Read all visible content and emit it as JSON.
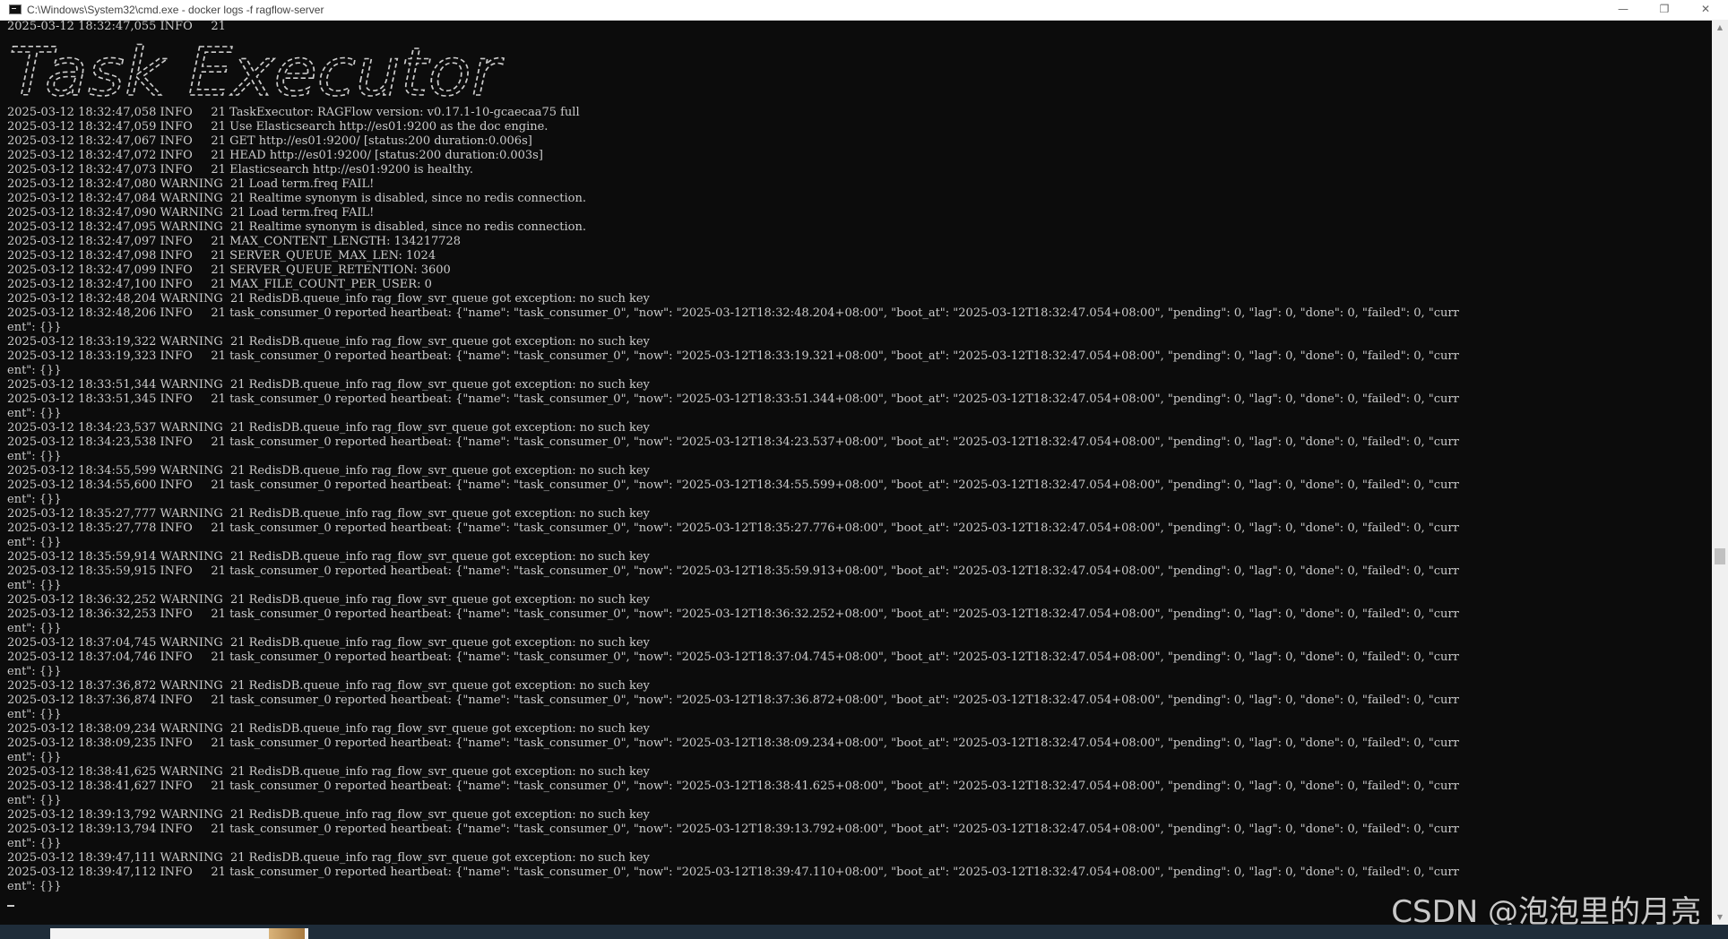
{
  "window": {
    "title": "C:\\Windows\\System32\\cmd.exe - docker  logs -f ragflow-server",
    "minimize_glyph": "—",
    "maximize_glyph": "❐",
    "close_glyph": "✕"
  },
  "console": {
    "first_line": "2025-03-12 18:32:47,055 INFO     21",
    "banner_text": "Task Executor",
    "lines": [
      "2025-03-12 18:32:47,058 INFO     21 TaskExecutor: RAGFlow version: v0.17.1-10-gcaecaa75 full",
      "2025-03-12 18:32:47,059 INFO     21 Use Elasticsearch http://es01:9200 as the doc engine.",
      "2025-03-12 18:32:47,067 INFO     21 GET http://es01:9200/ [status:200 duration:0.006s]",
      "2025-03-12 18:32:47,072 INFO     21 HEAD http://es01:9200/ [status:200 duration:0.003s]",
      "2025-03-12 18:32:47,073 INFO     21 Elasticsearch http://es01:9200 is healthy.",
      "2025-03-12 18:32:47,080 WARNING  21 Load term.freq FAIL!",
      "2025-03-12 18:32:47,084 WARNING  21 Realtime synonym is disabled, since no redis connection.",
      "2025-03-12 18:32:47,090 WARNING  21 Load term.freq FAIL!",
      "2025-03-12 18:32:47,095 WARNING  21 Realtime synonym is disabled, since no redis connection.",
      "2025-03-12 18:32:47,097 INFO     21 MAX_CONTENT_LENGTH: 134217728",
      "2025-03-12 18:32:47,098 INFO     21 SERVER_QUEUE_MAX_LEN: 1024",
      "2025-03-12 18:32:47,099 INFO     21 SERVER_QUEUE_RETENTION: 3600",
      "2025-03-12 18:32:47,100 INFO     21 MAX_FILE_COUNT_PER_USER: 0",
      "2025-03-12 18:32:48,204 WARNING  21 RedisDB.queue_info rag_flow_svr_queue got exception: no such key",
      "2025-03-12 18:32:48,206 INFO     21 task_consumer_0 reported heartbeat: {\"name\": \"task_consumer_0\", \"now\": \"2025-03-12T18:32:48.204+08:00\", \"boot_at\": \"2025-03-12T18:32:47.054+08:00\", \"pending\": 0, \"lag\": 0, \"done\": 0, \"failed\": 0, \"curr",
      "ent\": {}}",
      "2025-03-12 18:33:19,322 WARNING  21 RedisDB.queue_info rag_flow_svr_queue got exception: no such key",
      "2025-03-12 18:33:19,323 INFO     21 task_consumer_0 reported heartbeat: {\"name\": \"task_consumer_0\", \"now\": \"2025-03-12T18:33:19.321+08:00\", \"boot_at\": \"2025-03-12T18:32:47.054+08:00\", \"pending\": 0, \"lag\": 0, \"done\": 0, \"failed\": 0, \"curr",
      "ent\": {}}",
      "2025-03-12 18:33:51,344 WARNING  21 RedisDB.queue_info rag_flow_svr_queue got exception: no such key",
      "2025-03-12 18:33:51,345 INFO     21 task_consumer_0 reported heartbeat: {\"name\": \"task_consumer_0\", \"now\": \"2025-03-12T18:33:51.344+08:00\", \"boot_at\": \"2025-03-12T18:32:47.054+08:00\", \"pending\": 0, \"lag\": 0, \"done\": 0, \"failed\": 0, \"curr",
      "ent\": {}}",
      "2025-03-12 18:34:23,537 WARNING  21 RedisDB.queue_info rag_flow_svr_queue got exception: no such key",
      "2025-03-12 18:34:23,538 INFO     21 task_consumer_0 reported heartbeat: {\"name\": \"task_consumer_0\", \"now\": \"2025-03-12T18:34:23.537+08:00\", \"boot_at\": \"2025-03-12T18:32:47.054+08:00\", \"pending\": 0, \"lag\": 0, \"done\": 0, \"failed\": 0, \"curr",
      "ent\": {}}",
      "2025-03-12 18:34:55,599 WARNING  21 RedisDB.queue_info rag_flow_svr_queue got exception: no such key",
      "2025-03-12 18:34:55,600 INFO     21 task_consumer_0 reported heartbeat: {\"name\": \"task_consumer_0\", \"now\": \"2025-03-12T18:34:55.599+08:00\", \"boot_at\": \"2025-03-12T18:32:47.054+08:00\", \"pending\": 0, \"lag\": 0, \"done\": 0, \"failed\": 0, \"curr",
      "ent\": {}}",
      "2025-03-12 18:35:27,777 WARNING  21 RedisDB.queue_info rag_flow_svr_queue got exception: no such key",
      "2025-03-12 18:35:27,778 INFO     21 task_consumer_0 reported heartbeat: {\"name\": \"task_consumer_0\", \"now\": \"2025-03-12T18:35:27.776+08:00\", \"boot_at\": \"2025-03-12T18:32:47.054+08:00\", \"pending\": 0, \"lag\": 0, \"done\": 0, \"failed\": 0, \"curr",
      "ent\": {}}",
      "2025-03-12 18:35:59,914 WARNING  21 RedisDB.queue_info rag_flow_svr_queue got exception: no such key",
      "2025-03-12 18:35:59,915 INFO     21 task_consumer_0 reported heartbeat: {\"name\": \"task_consumer_0\", \"now\": \"2025-03-12T18:35:59.913+08:00\", \"boot_at\": \"2025-03-12T18:32:47.054+08:00\", \"pending\": 0, \"lag\": 0, \"done\": 0, \"failed\": 0, \"curr",
      "ent\": {}}",
      "2025-03-12 18:36:32,252 WARNING  21 RedisDB.queue_info rag_flow_svr_queue got exception: no such key",
      "2025-03-12 18:36:32,253 INFO     21 task_consumer_0 reported heartbeat: {\"name\": \"task_consumer_0\", \"now\": \"2025-03-12T18:36:32.252+08:00\", \"boot_at\": \"2025-03-12T18:32:47.054+08:00\", \"pending\": 0, \"lag\": 0, \"done\": 0, \"failed\": 0, \"curr",
      "ent\": {}}",
      "2025-03-12 18:37:04,745 WARNING  21 RedisDB.queue_info rag_flow_svr_queue got exception: no such key",
      "2025-03-12 18:37:04,746 INFO     21 task_consumer_0 reported heartbeat: {\"name\": \"task_consumer_0\", \"now\": \"2025-03-12T18:37:04.745+08:00\", \"boot_at\": \"2025-03-12T18:32:47.054+08:00\", \"pending\": 0, \"lag\": 0, \"done\": 0, \"failed\": 0, \"curr",
      "ent\": {}}",
      "2025-03-12 18:37:36,872 WARNING  21 RedisDB.queue_info rag_flow_svr_queue got exception: no such key",
      "2025-03-12 18:37:36,874 INFO     21 task_consumer_0 reported heartbeat: {\"name\": \"task_consumer_0\", \"now\": \"2025-03-12T18:37:36.872+08:00\", \"boot_at\": \"2025-03-12T18:32:47.054+08:00\", \"pending\": 0, \"lag\": 0, \"done\": 0, \"failed\": 0, \"curr",
      "ent\": {}}",
      "2025-03-12 18:38:09,234 WARNING  21 RedisDB.queue_info rag_flow_svr_queue got exception: no such key",
      "2025-03-12 18:38:09,235 INFO     21 task_consumer_0 reported heartbeat: {\"name\": \"task_consumer_0\", \"now\": \"2025-03-12T18:38:09.234+08:00\", \"boot_at\": \"2025-03-12T18:32:47.054+08:00\", \"pending\": 0, \"lag\": 0, \"done\": 0, \"failed\": 0, \"curr",
      "ent\": {}}",
      "2025-03-12 18:38:41,625 WARNING  21 RedisDB.queue_info rag_flow_svr_queue got exception: no such key",
      "2025-03-12 18:38:41,627 INFO     21 task_consumer_0 reported heartbeat: {\"name\": \"task_consumer_0\", \"now\": \"2025-03-12T18:38:41.625+08:00\", \"boot_at\": \"2025-03-12T18:32:47.054+08:00\", \"pending\": 0, \"lag\": 0, \"done\": 0, \"failed\": 0, \"curr",
      "ent\": {}}",
      "2025-03-12 18:39:13,792 WARNING  21 RedisDB.queue_info rag_flow_svr_queue got exception: no such key",
      "2025-03-12 18:39:13,794 INFO     21 task_consumer_0 reported heartbeat: {\"name\": \"task_consumer_0\", \"now\": \"2025-03-12T18:39:13.792+08:00\", \"boot_at\": \"2025-03-12T18:32:47.054+08:00\", \"pending\": 0, \"lag\": 0, \"done\": 0, \"failed\": 0, \"curr",
      "ent\": {}}",
      "2025-03-12 18:39:47,111 WARNING  21 RedisDB.queue_info rag_flow_svr_queue got exception: no such key",
      "2025-03-12 18:39:47,112 INFO     21 task_consumer_0 reported heartbeat: {\"name\": \"task_consumer_0\", \"now\": \"2025-03-12T18:39:47.110+08:00\", \"boot_at\": \"2025-03-12T18:32:47.054+08:00\", \"pending\": 0, \"lag\": 0, \"done\": 0, \"failed\": 0, \"curr",
      "ent\": {}}"
    ]
  },
  "watermark": "CSDN @泡泡里的月亮",
  "colors": {
    "console_bg": "#0c0c0c",
    "console_fg": "#cccccc",
    "titlebar_bg": "#ffffff",
    "taskbar_bg": "#1f2d3a"
  }
}
